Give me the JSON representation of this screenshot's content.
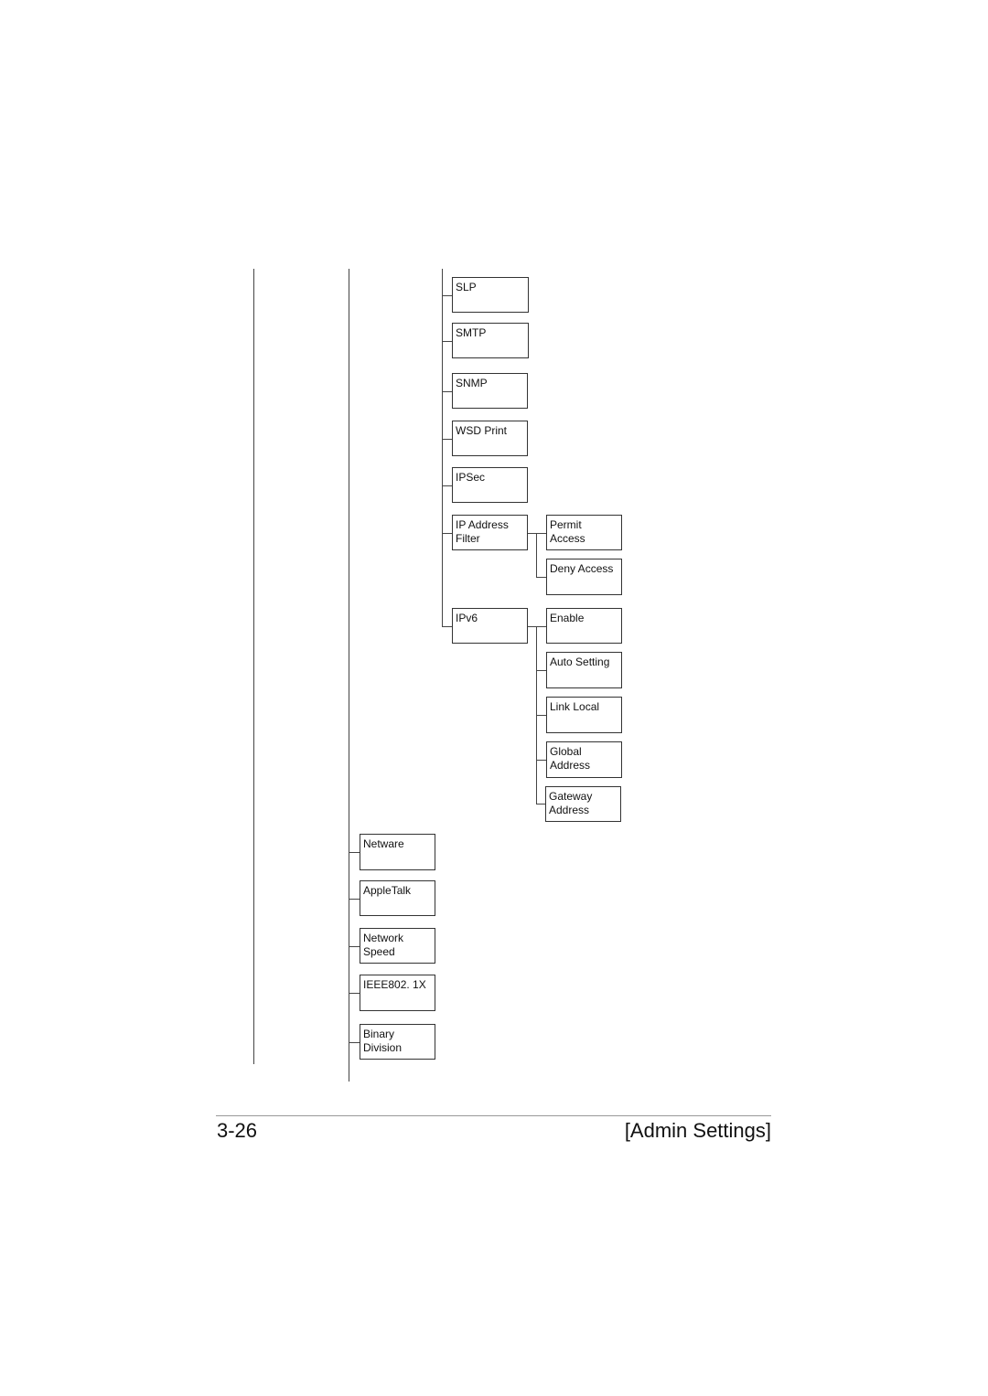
{
  "tree": {
    "level3_items": {
      "slp": "SLP",
      "smtp": "SMTP",
      "snmp": "SNMP",
      "wsd_print": "WSD Print",
      "ipsec": "IPSec",
      "ip_address_filter": "IP Address\nFilter",
      "ipv6": "IPv6"
    },
    "ip_address_filter_children": {
      "permit_access": "Permit\nAccess",
      "deny_access": "Deny Access"
    },
    "ipv6_children": {
      "enable": "Enable",
      "auto_setting": "Auto Setting",
      "link_local": "Link Local",
      "global_address": "Global\nAddress",
      "gateway_address": "Gateway\nAddress"
    },
    "level2_items": {
      "netware": "Netware",
      "appletalk": "AppleTalk",
      "network_speed": "Network\nSpeed",
      "ieee8021x": "IEEE802. 1X",
      "binary_division": "Binary\nDivision"
    }
  },
  "footer": {
    "page_number": "3-26",
    "section_title": "[Admin Settings]"
  }
}
